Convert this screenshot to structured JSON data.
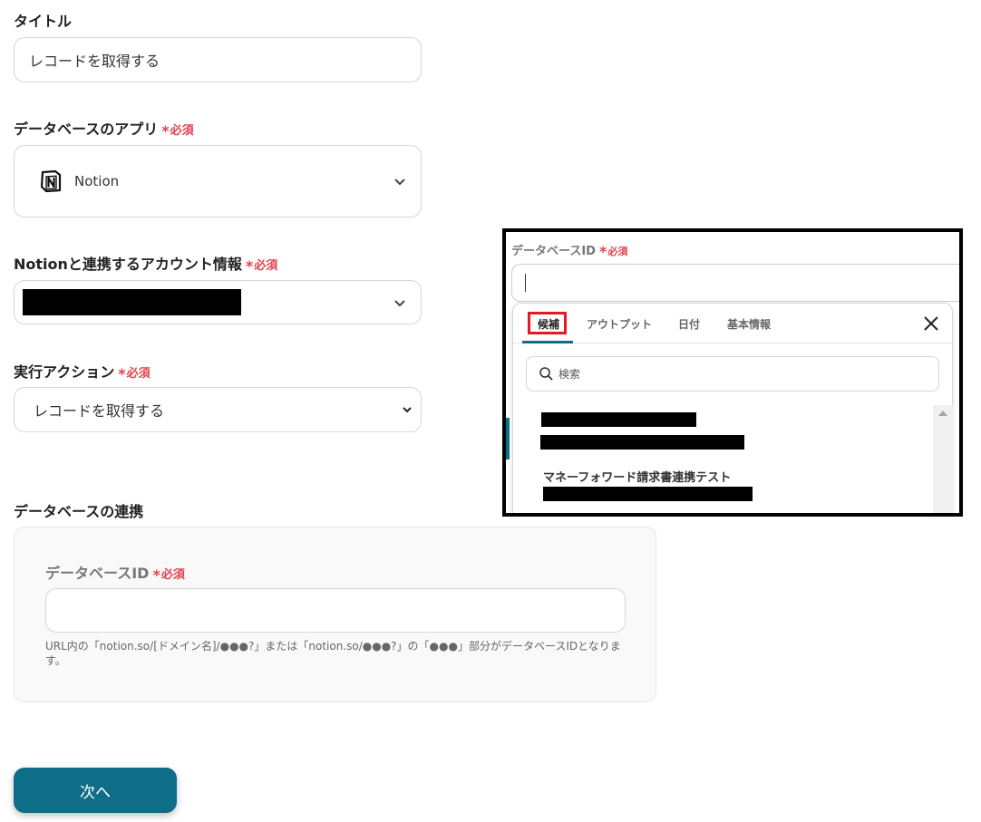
{
  "title_field": {
    "label": "タイトル",
    "value": "レコードを取得する"
  },
  "app_field": {
    "label": "データベースのアプリ",
    "required": "必須",
    "value": "Notion",
    "icon": "notion-logo-icon"
  },
  "account_field": {
    "label": "Notionと連携するアカウント情報",
    "required": "必須"
  },
  "action_field": {
    "label": "実行アクション",
    "required": "必須",
    "value": "レコードを取得する"
  },
  "db_section": {
    "heading": "データベースの連携",
    "id_label": "データベースID",
    "required": "必須",
    "value": "",
    "help_line1": "URL内の「notion.so/[ドメイン名]/●●●?」または「notion.so/●●●?」の「●●●」部分がデータベースIDとなりま",
    "help_line2": "す。"
  },
  "next_button": {
    "label": "次へ"
  },
  "inset": {
    "label": "データベースID",
    "required": "必須",
    "tabs": [
      {
        "label": "候補",
        "active": true
      },
      {
        "label": "アウトプット",
        "active": false
      },
      {
        "label": "日付",
        "active": false
      },
      {
        "label": "基本情報",
        "active": false
      }
    ],
    "search_placeholder": "検索",
    "list_item_title": "マネーフォワード請求書連携テスト"
  },
  "colors": {
    "accent": "#0e6e87",
    "required": "#e0434f",
    "highlight": "#e21b23"
  }
}
